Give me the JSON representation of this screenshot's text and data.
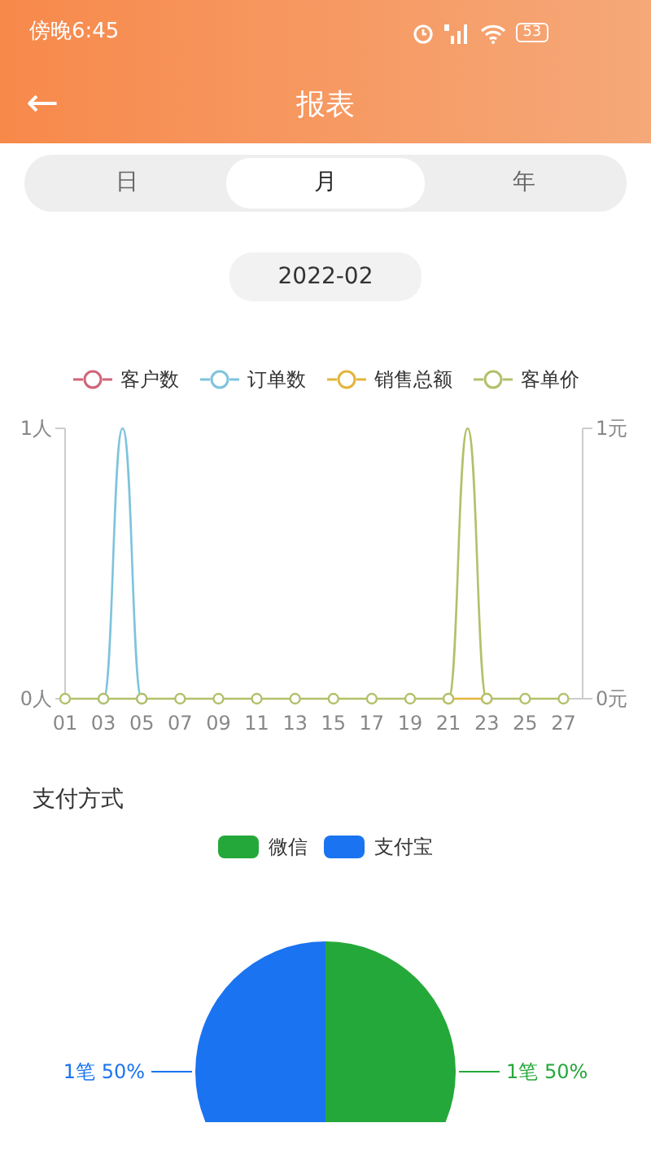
{
  "status_bar": {
    "time": "傍晚6:45",
    "battery": "53"
  },
  "header": {
    "title": "报表",
    "back": "←"
  },
  "period_tabs": [
    {
      "label": "日",
      "selected": false
    },
    {
      "label": "月",
      "selected": true
    },
    {
      "label": "年",
      "selected": false
    }
  ],
  "date": "2022-02",
  "trend_chart": {
    "chart_data": {
      "type": "line",
      "x": [
        1,
        2,
        3,
        4,
        5,
        6,
        7,
        8,
        9,
        10,
        11,
        12,
        13,
        14,
        15,
        16,
        17,
        18,
        19,
        20,
        21,
        22,
        23,
        24,
        25,
        26,
        27
      ],
      "xticks": [
        {
          "value": 1,
          "label": "01"
        },
        {
          "value": 3,
          "label": "03"
        },
        {
          "value": 5,
          "label": "05"
        },
        {
          "value": 7,
          "label": "07"
        },
        {
          "value": 9,
          "label": "09"
        },
        {
          "value": 11,
          "label": "11"
        },
        {
          "value": 13,
          "label": "13"
        },
        {
          "value": 15,
          "label": "15"
        },
        {
          "value": 17,
          "label": "17"
        },
        {
          "value": 19,
          "label": "19"
        },
        {
          "value": 21,
          "label": "21"
        },
        {
          "value": 23,
          "label": "23"
        },
        {
          "value": 25,
          "label": "25"
        },
        {
          "value": 27,
          "label": "27"
        }
      ],
      "yticks": [
        {
          "value": 0,
          "label": "0人"
        },
        {
          "value": 1,
          "label": "1人"
        }
      ],
      "y2ticks": [
        {
          "value": 0,
          "label": "0元"
        },
        {
          "value": 1,
          "label": "1元"
        }
      ],
      "xlim": [
        1,
        28
      ],
      "ylim": [
        0,
        1
      ],
      "y2lim": [
        0,
        1
      ],
      "series": [
        {
          "name": "客户数",
          "color": "#d0647a",
          "values": [
            null,
            null,
            null,
            null,
            null,
            null,
            null,
            null,
            null,
            null,
            null,
            null,
            null,
            null,
            null,
            null,
            null,
            null,
            null,
            null,
            null,
            null,
            null,
            null,
            null,
            null,
            null
          ]
        },
        {
          "name": "订单数",
          "color": "#7ec3dd",
          "values": [
            null,
            null,
            0,
            1,
            0,
            null,
            null,
            null,
            null,
            null,
            null,
            null,
            null,
            null,
            null,
            null,
            null,
            null,
            null,
            null,
            null,
            null,
            null,
            null,
            null,
            null,
            null
          ]
        },
        {
          "name": "销售总额",
          "color": "#e3b53c",
          "values": [
            null,
            null,
            null,
            null,
            null,
            null,
            null,
            null,
            null,
            null,
            null,
            null,
            null,
            null,
            null,
            null,
            null,
            null,
            null,
            null,
            0,
            0,
            0,
            null,
            null,
            null,
            null
          ]
        },
        {
          "name": "客单价",
          "color": "#b3c06a",
          "values": [
            0,
            0,
            0,
            0,
            0,
            0,
            0,
            0,
            0,
            0,
            0,
            0,
            0,
            0,
            0,
            0,
            0,
            0,
            0,
            0,
            0,
            1,
            0,
            0,
            0,
            0,
            0
          ]
        }
      ]
    }
  },
  "payment": {
    "title": "支付方式",
    "chart_data": {
      "type": "pie",
      "categories": [
        "微信",
        "支付宝"
      ],
      "series": [
        {
          "values": [
            50,
            50
          ]
        }
      ],
      "colors": [
        "#25a83a",
        "#1a73f0"
      ],
      "value_labels": [
        "1笔 50%",
        "1笔 50%"
      ]
    }
  }
}
